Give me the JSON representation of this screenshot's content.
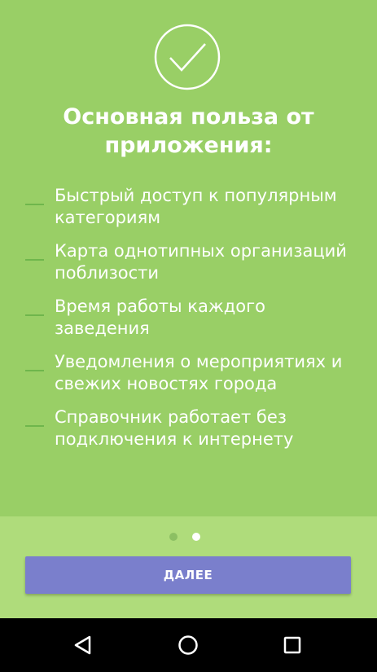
{
  "onboarding": {
    "title": "Основная польза от приложения:",
    "benefits": [
      "Быстрый доступ к популярным категориям",
      "Карта однотипных организаций поблизости",
      "Время работы каждого заведения",
      "Уведомления о мероприятиях и свежих новостях города",
      "Справочник работает без подключения к интернету"
    ],
    "pager": {
      "total": 2,
      "active": 2
    },
    "next_label": "ДАЛЕЕ"
  },
  "icons": {
    "header": "check-circle-icon",
    "bullet": "dash-icon",
    "nav_back": "back-triangle-icon",
    "nav_home": "home-circle-icon",
    "nav_recents": "recents-square-icon"
  },
  "colors": {
    "background": "#99cf66",
    "footer": "#afdc7b",
    "button": "#7a7fcc",
    "bullet": "#6fb64c",
    "dot_inactive": "#8cbf63",
    "dot_active": "#ffffff",
    "navbar": "#000000"
  }
}
